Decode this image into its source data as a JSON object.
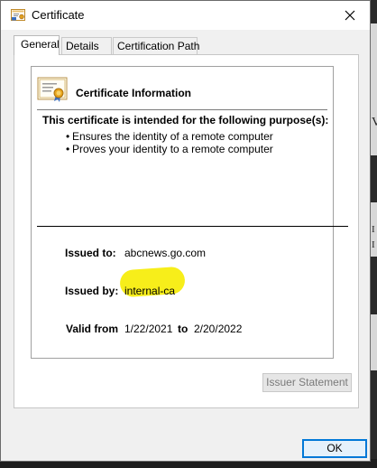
{
  "window": {
    "title": "Certificate",
    "title_icon": "certificate-icon",
    "close_icon": "close-icon"
  },
  "tabs": [
    {
      "label": "General",
      "active": true
    },
    {
      "label": "Details",
      "active": false
    },
    {
      "label": "Certification Path",
      "active": false
    }
  ],
  "general": {
    "heading": "Certificate Information",
    "heading_icon": "certificate-ribbon-icon",
    "purpose_heading": "This certificate is intended for the following purpose(s):",
    "purposes": [
      "Ensures the identity of a remote computer",
      "Proves your identity to a remote computer"
    ],
    "issued_to_label": "Issued to:",
    "issued_to": "abcnews.go.com",
    "issued_by_label": "Issued by:",
    "issued_by": "internal-ca",
    "valid_from_label": "Valid from",
    "valid_from": "1/22/2021",
    "valid_to_label": "to",
    "valid_to": "2/20/2022",
    "highlight_color": "#f7ee1a"
  },
  "buttons": {
    "issuer_statement": "Issuer Statement",
    "ok": "OK"
  },
  "background": {
    "glyphs": [
      "V",
      "I",
      "I"
    ]
  },
  "colors": {
    "accent": "#0078d7"
  }
}
